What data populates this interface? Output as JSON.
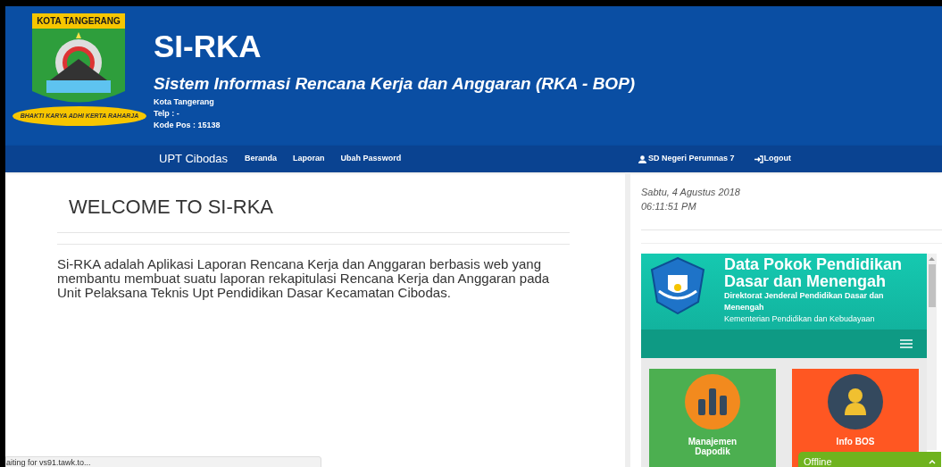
{
  "header": {
    "logo_banner": "KOTA TANGERANG",
    "logo_motto": "BHAKTI KARYA ADHI KERTA RAHARJA",
    "title": "SI-RKA",
    "subtitle": "Sistem Informasi Rencana Kerja dan Anggaran (RKA - BOP)",
    "info": [
      "Kota Tangerang",
      "Telp : -",
      "Kode Pos : 15138"
    ]
  },
  "nav": {
    "brand": "UPT Cibodas",
    "links": [
      {
        "label": "Beranda"
      },
      {
        "label": "Laporan"
      },
      {
        "label": "Ubah Password"
      }
    ],
    "user": "SD Negeri Perumnas 7",
    "logout": "Logout"
  },
  "main": {
    "heading": "WELCOME TO SI-RKA",
    "paragraph": "Si-RKA adalah Aplikasi Laporan Rencana Kerja dan Anggaran berbasis web yang membantu membuat suatu laporan rekapitulasi Rencana Kerja dan Anggaran pada Unit Pelaksana Teknis Upt Pendidikan Dasar Kecamatan Cibodas."
  },
  "sidebar": {
    "date": "Sabtu, 4 Agustus 2018",
    "time": "06:11:51 PM",
    "widget": {
      "title": "Data Pokok Pendidikan Dasar dan Menengah",
      "org": "Direktorat Jenderal Pendidikan Dasar dan Menengah",
      "ministry": "Kementerian Pendidikan dan Kebudayaan",
      "tiles": [
        {
          "kind": "chart",
          "label": "Manajemen Dapodik",
          "color": "#4caf50"
        },
        {
          "kind": "person",
          "label": "Info BOS",
          "color": "#ff5722"
        }
      ]
    }
  },
  "chat": {
    "status": "Offline"
  },
  "status_bar": "aiting for vs91.tawk.to..."
}
